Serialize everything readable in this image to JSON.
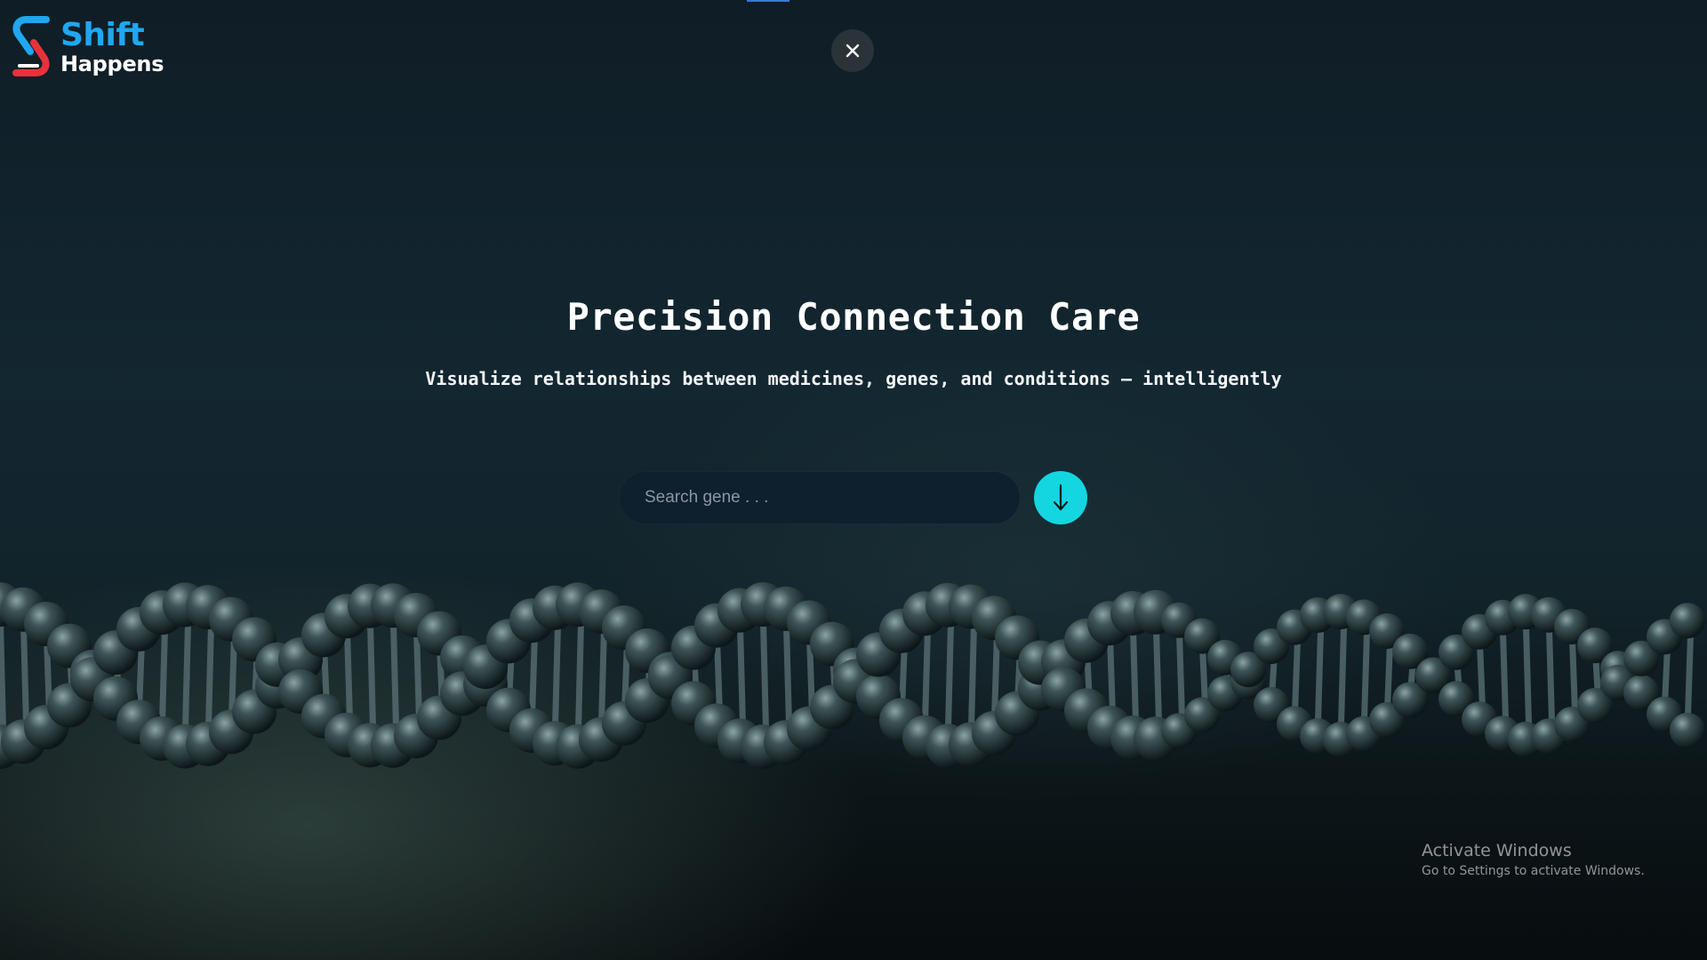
{
  "brand": {
    "name_line1": "Shift",
    "name_line2": "Happens",
    "accent_color": "#1fa7f0",
    "mark_red": "#e8323a"
  },
  "close_button": {
    "icon": "close-icon"
  },
  "hero": {
    "title": "Precision Connection Care",
    "subtitle": "Visualize relationships between medicines, genes, and conditions — intelligently"
  },
  "search": {
    "placeholder": "Search gene . . .",
    "value": "",
    "submit_icon": "arrow-down-icon",
    "submit_color": "#13d6e0"
  },
  "background": {
    "illustration": "dna-helix"
  },
  "watermark": {
    "title": "Activate Windows",
    "subtitle": "Go to Settings to activate Windows."
  }
}
